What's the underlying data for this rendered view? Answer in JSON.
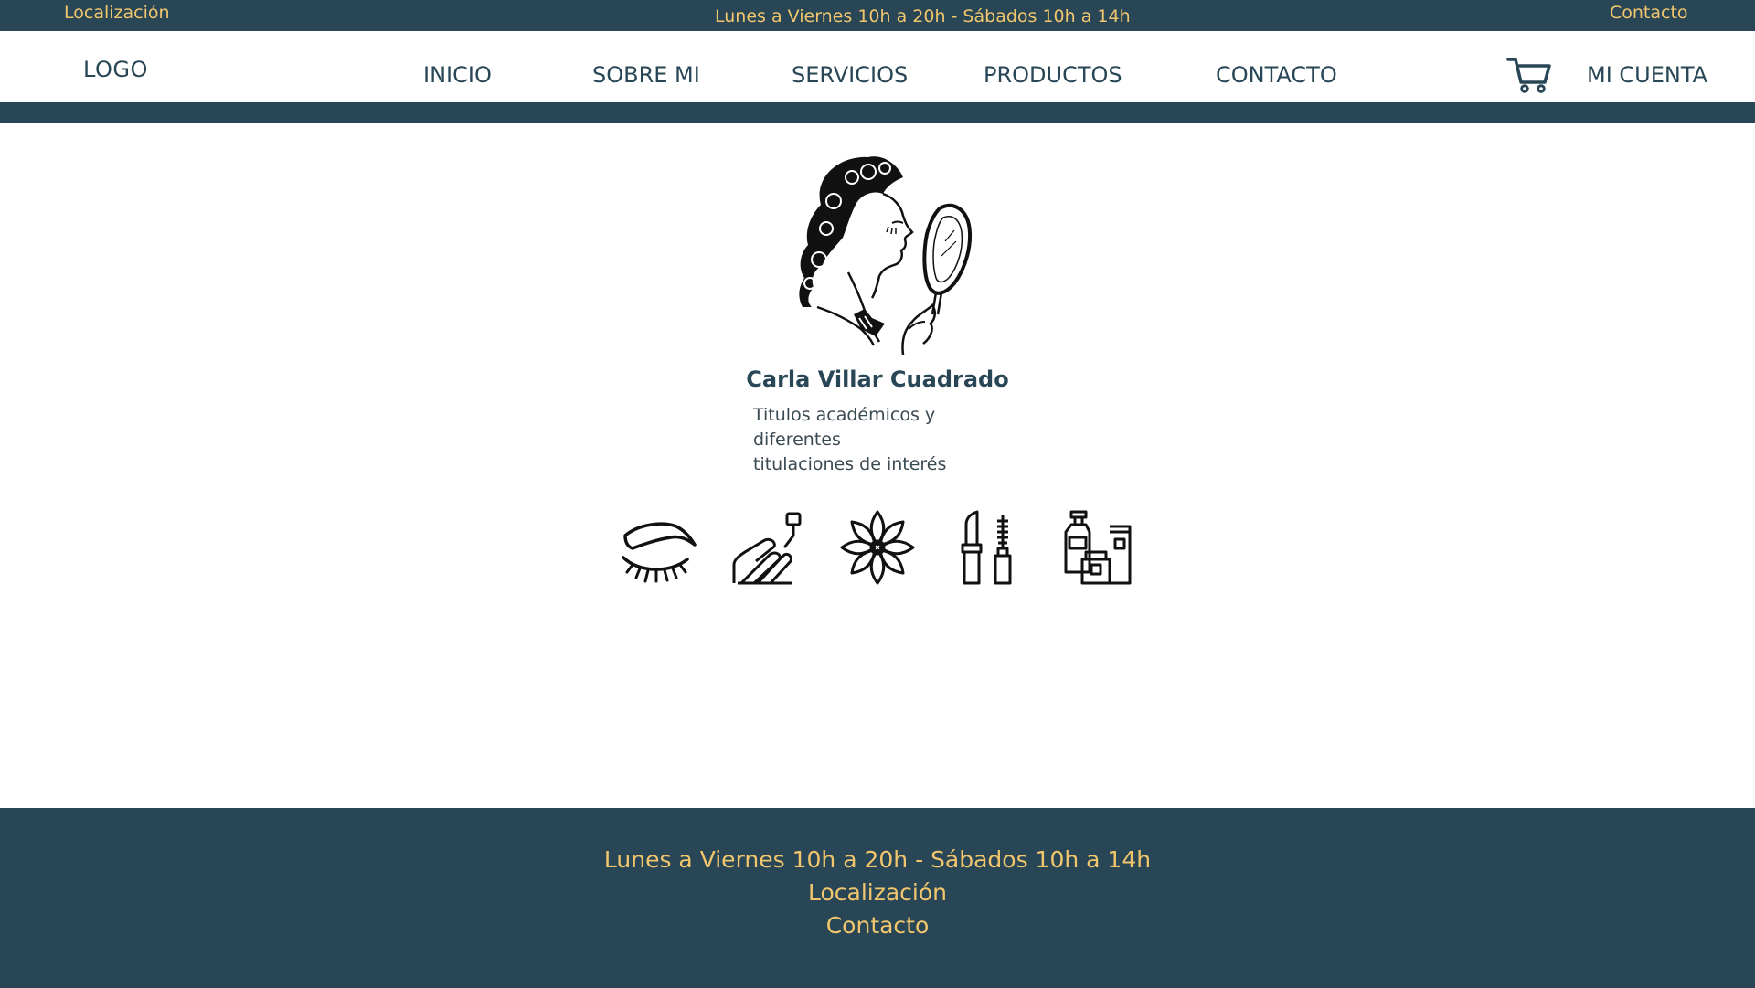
{
  "topbar": {
    "location": "Localización",
    "hours": "Lunes a Viernes 10h a 20h - Sábados 10h a 14h",
    "contact": "Contacto"
  },
  "nav": {
    "logo": "LOGO",
    "items": [
      "INICIO",
      "SOBRE MI",
      "SERVICIOS",
      "PRODUCTOS",
      "CONTACTO"
    ],
    "cart_icon": "shopping-cart-icon",
    "account": "MI CUENTA"
  },
  "profile": {
    "image": "vintage-woman-with-mirror-illustration",
    "name": "Carla Villar Cuadrado",
    "subtitle_line1": "Titulos académicos y diferentes",
    "subtitle_line2": "titulaciones de interés"
  },
  "services": {
    "icons": [
      "eyebrow-eyelash-icon",
      "nail-polish-icon",
      "flower-icon",
      "lipstick-mascara-icon",
      "cosmetics-products-icon"
    ]
  },
  "footer": {
    "hours": "Lunes a Viernes 10h a 20h - Sábados 10h a 14h",
    "location": "Localización",
    "contact": "Contacto"
  },
  "colors": {
    "primary": "#284655",
    "accent": "#f2c66d",
    "background": "#ffffff"
  }
}
